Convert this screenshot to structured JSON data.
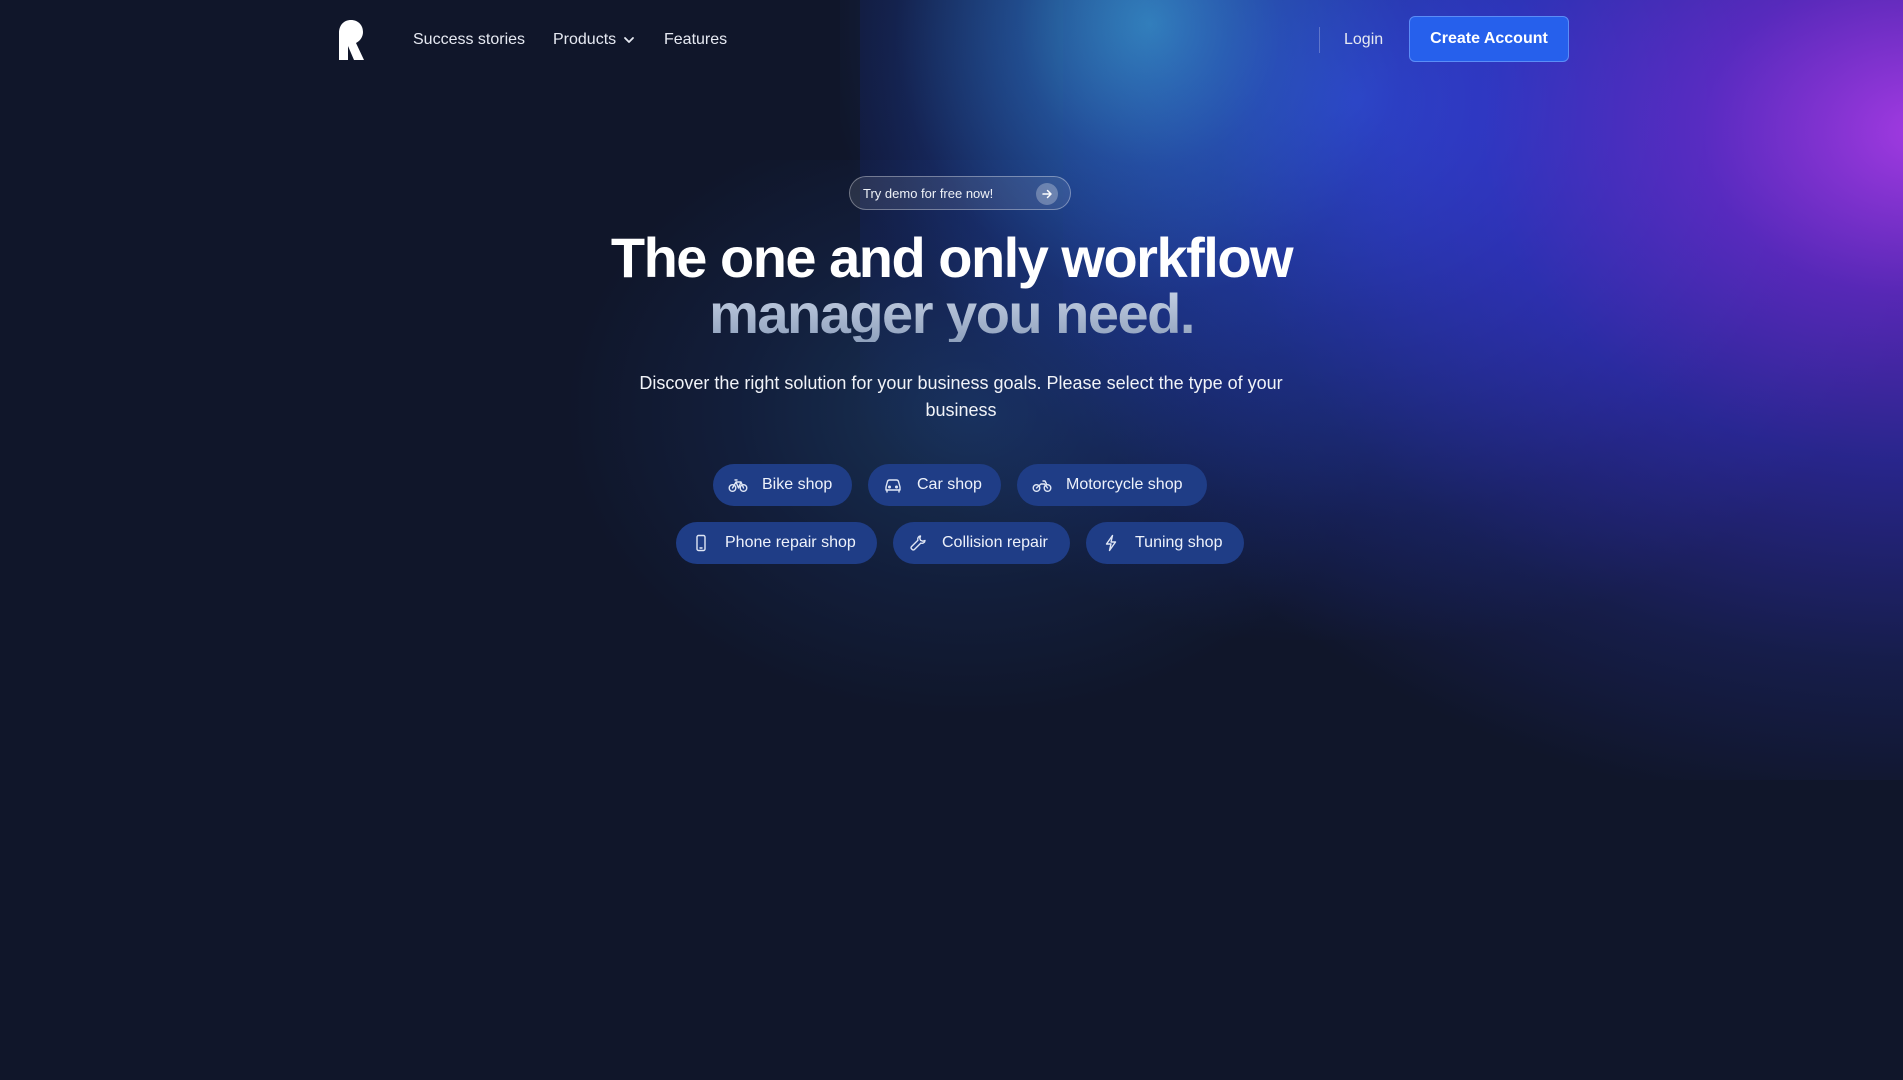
{
  "header": {
    "nav": {
      "success_stories": "Success stories",
      "products": "Products",
      "features": "Features"
    },
    "login": "Login",
    "create_account": "Create Account"
  },
  "hero": {
    "demo_pill": "Try demo for free now!",
    "headline_line1": "The one and only workflow",
    "headline_line2": "manager you need.",
    "subtitle": "Discover the right solution for your business goals. Please select the type of your business"
  },
  "business_types": [
    {
      "label": "Bike shop",
      "icon": "bicycle-icon"
    },
    {
      "label": "Car shop",
      "icon": "car-icon"
    },
    {
      "label": "Motorcycle shop",
      "icon": "motorcycle-icon"
    },
    {
      "label": "Phone repair shop",
      "icon": "smartphone-icon"
    },
    {
      "label": "Collision repair",
      "icon": "wrench-icon"
    },
    {
      "label": "Tuning shop",
      "icon": "lightning-icon"
    }
  ],
  "colors": {
    "background": "#10162a",
    "primary_button": "#2660ec",
    "pill_background": "#1f3d86"
  }
}
